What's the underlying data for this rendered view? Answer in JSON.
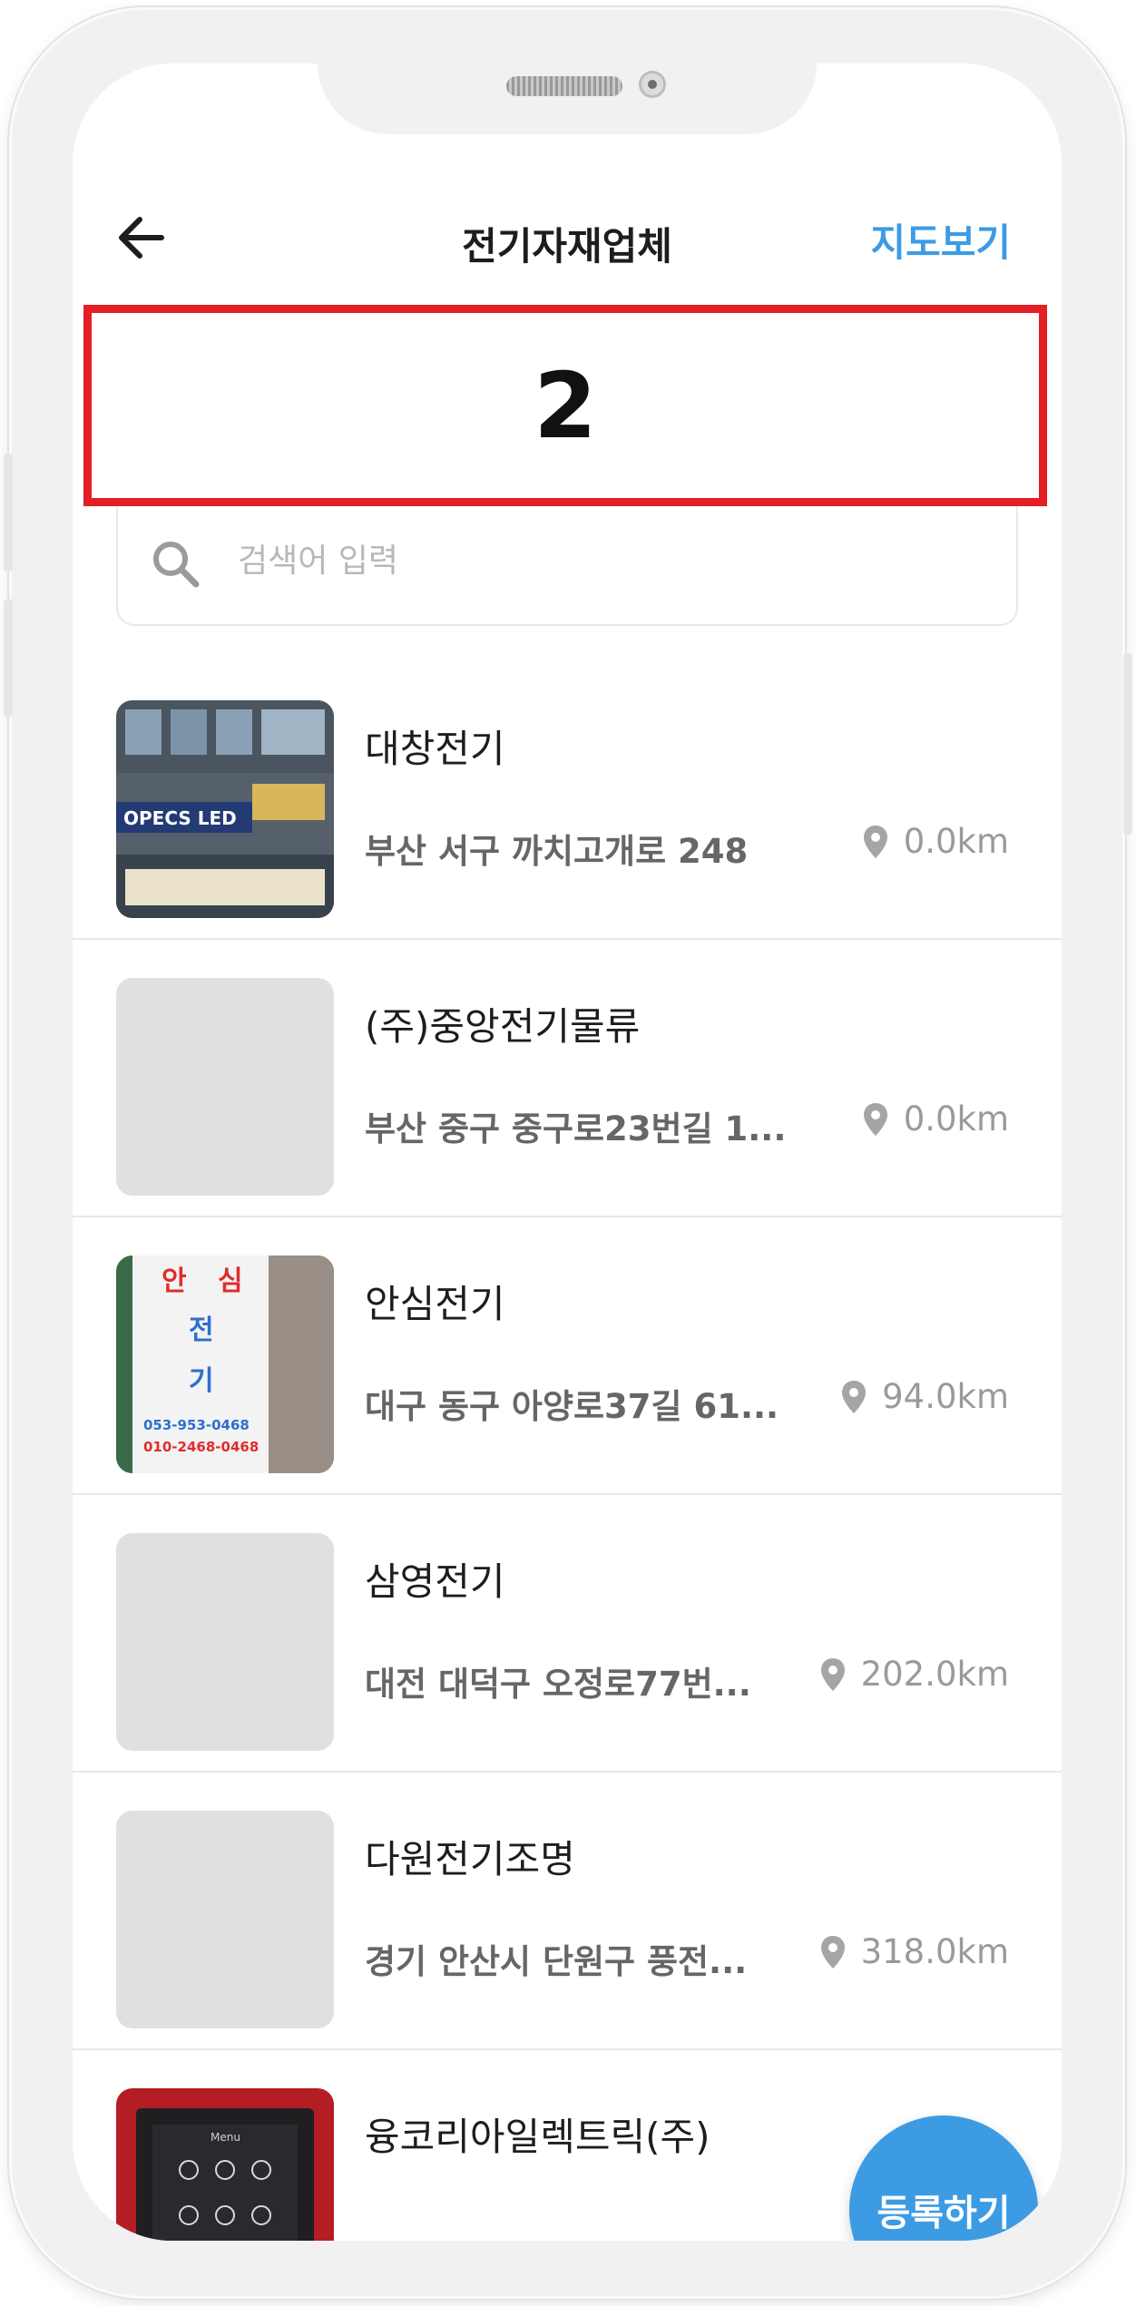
{
  "header": {
    "title": "전기자재업체",
    "map_link": "지도보기",
    "back_icon": "arrow-left-icon"
  },
  "highlight": {
    "number": "2"
  },
  "search": {
    "placeholder": "검색어 입력",
    "icon": "search-icon"
  },
  "list": [
    {
      "name": "대창전기",
      "address": "부산 서구 까치고개로 248",
      "distance": "0.0km",
      "thumb": "storefront-photo",
      "thumb_text": "OPECS LED"
    },
    {
      "name": "(주)중앙전기물류",
      "address": "부산 중구 중구로23번길 1...",
      "distance": "0.0km",
      "thumb": "placeholder"
    },
    {
      "name": "안심전기",
      "address": "대구 동구 아양로37길 61...",
      "distance": "94.0km",
      "thumb": "sign-photo",
      "thumb_text": [
        "안",
        "심",
        "전",
        "기",
        "053-953-0468",
        "010-2468-0468"
      ]
    },
    {
      "name": "삼영전기",
      "address": "대전 대덕구 오정로77번...",
      "distance": "202.0km",
      "thumb": "placeholder"
    },
    {
      "name": "다원전기조명",
      "address": "경기 안산시 단원구 풍전...",
      "distance": "318.0km",
      "thumb": "placeholder"
    },
    {
      "name": "융코리아일렉트릭(주)",
      "address": "",
      "distance": "",
      "thumb": "device-photo",
      "thumb_text": "Menu"
    }
  ],
  "fab": {
    "label": "등록하기"
  },
  "colors": {
    "accent": "#3d9be4",
    "highlight_border": "#e31e24"
  }
}
